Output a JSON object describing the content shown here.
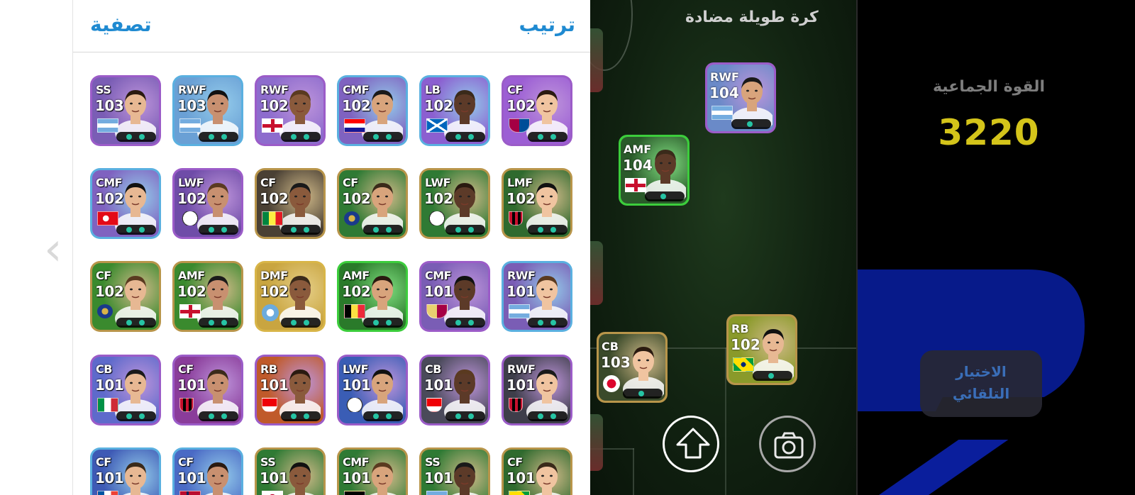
{
  "panel": {
    "filter_label": "تصفية",
    "sort_label": "ترتيب",
    "cards": [
      {
        "pos": "SS",
        "rating": "103",
        "flag": "argentina",
        "frame": "#9b5cc8",
        "bg": "#7a5db5"
      },
      {
        "pos": "RWF",
        "rating": "103",
        "flag": "argentina",
        "frame": "#5ab0e0",
        "bg": "#6aa0d5"
      },
      {
        "pos": "RWF",
        "rating": "102",
        "flag": "england",
        "frame": "#9b5cc8",
        "bg": "#8d6ccd"
      },
      {
        "pos": "CMF",
        "rating": "102",
        "flag": "croatia",
        "frame": "#5ab0e0",
        "bg": "#7f62c0"
      },
      {
        "pos": "LB",
        "rating": "102",
        "flag": "scotland",
        "frame": "#5ab0e0",
        "bg": "#8b5fd0"
      },
      {
        "pos": "CF",
        "rating": "102",
        "flag": "barcelona",
        "frame": "#9b5cc8",
        "bg": "#9c5ed4"
      },
      {
        "pos": "CMF",
        "rating": "102",
        "flag": "turkey",
        "frame": "#5ab0e0",
        "bg": "#7f62c0"
      },
      {
        "pos": "LWF",
        "rating": "102",
        "flag": "realmadrid",
        "frame": "#9b5cc8",
        "bg": "#6f4ca8"
      },
      {
        "pos": "CF",
        "rating": "102",
        "flag": "senegal",
        "frame": "#b8954a",
        "bg": "#4a4034"
      },
      {
        "pos": "CF",
        "rating": "102",
        "flag": "inter",
        "frame": "#b8954a",
        "bg": "#2f7a34"
      },
      {
        "pos": "LWF",
        "rating": "102",
        "flag": "realmadrid",
        "frame": "#b8954a",
        "bg": "#2f7a34"
      },
      {
        "pos": "LMF",
        "rating": "102",
        "flag": "milan",
        "frame": "#b8954a",
        "bg": "#2f6a2e"
      },
      {
        "pos": "CF",
        "rating": "102",
        "flag": "inter",
        "frame": "#b8954a",
        "bg": "#3a8a2e"
      },
      {
        "pos": "AMF",
        "rating": "102",
        "flag": "england",
        "frame": "#b8954a",
        "bg": "#3a8a2e"
      },
      {
        "pos": "DMF",
        "rating": "102",
        "flag": "mancity",
        "frame": "#d8b548",
        "bg": "#c9a540"
      },
      {
        "pos": "AMF",
        "rating": "102",
        "flag": "belgium",
        "frame": "#3ccd3c",
        "bg": "#2a7a2a"
      },
      {
        "pos": "CMF",
        "rating": "101",
        "flag": "barcelona2",
        "frame": "#9b5cc8",
        "bg": "#7a5db5"
      },
      {
        "pos": "RWF",
        "rating": "101",
        "flag": "argentina",
        "frame": "#5ab0e0",
        "bg": "#7a5db5"
      },
      {
        "pos": "CB",
        "rating": "101",
        "flag": "italy",
        "frame": "#9b5cc8",
        "bg": "#5e6acb"
      },
      {
        "pos": "CF",
        "rating": "101",
        "flag": "milan",
        "frame": "#9b5cc8",
        "bg": "#8a3c9a"
      },
      {
        "pos": "RB",
        "rating": "101",
        "flag": "arsenal",
        "frame": "#9b5cc8",
        "bg": "#c05a2a"
      },
      {
        "pos": "LWF",
        "rating": "101",
        "flag": "realmadrid",
        "frame": "#9b5cc8",
        "bg": "#3a5db5"
      },
      {
        "pos": "CB",
        "rating": "101",
        "flag": "arsenal",
        "frame": "#9b5cc8",
        "bg": "#4a4a5a"
      },
      {
        "pos": "RWF",
        "rating": "101",
        "flag": "milan",
        "frame": "#9b5cc8",
        "bg": "#3e3e4a"
      },
      {
        "pos": "CF",
        "rating": "101",
        "flag": "france",
        "frame": "#5ab0e0",
        "bg": "#3e5ab5"
      },
      {
        "pos": "CF",
        "rating": "101",
        "flag": "norway",
        "frame": "#5ab0e0",
        "bg": "#4a6ac5"
      },
      {
        "pos": "SS",
        "rating": "101",
        "flag": "japan",
        "frame": "#b8954a",
        "bg": "#2f7a34"
      },
      {
        "pos": "CMF",
        "rating": "101",
        "flag": "germany",
        "frame": "#b8954a",
        "bg": "#2f7a34"
      },
      {
        "pos": "SS",
        "rating": "101",
        "flag": "argentina",
        "frame": "#b8954a",
        "bg": "#2f7a34"
      },
      {
        "pos": "CF",
        "rating": "101",
        "flag": "brazil",
        "frame": "#b8954a",
        "bg": "#2f6a2e"
      }
    ]
  },
  "pitch": {
    "formation_title": "كرة طويلة مضادة",
    "players": [
      {
        "pos": "RWF",
        "rating": "104",
        "flag": "argentina",
        "frame": "#9b5cc8",
        "bg": "#6a8ac8"
      },
      {
        "pos": "AMF",
        "rating": "104",
        "flag": "england",
        "frame": "#3ccd3c",
        "bg": "#2a5a2a"
      },
      {
        "pos": "CB",
        "rating": "103",
        "flag": "bayern",
        "frame": "#b8954a",
        "bg": "#3a4a2a"
      },
      {
        "pos": "RB",
        "rating": "102",
        "flag": "brazil",
        "frame": "#b8954a",
        "bg": "#8a9a2a"
      }
    ]
  },
  "sidebar": {
    "team_strength_label": "القوة الجماعية",
    "team_strength_value": "3220",
    "auto_select_line1": "الاختيار",
    "auto_select_line2": "التلقائي"
  },
  "icons": {
    "back": "chevron-left-icon",
    "upload": "arrow-up-icon",
    "camera": "camera-icon"
  },
  "colors": {
    "accent_blue": "#1f8ad1",
    "team_strength": "#d4c41a",
    "skill_dot": "#26c4a4"
  }
}
